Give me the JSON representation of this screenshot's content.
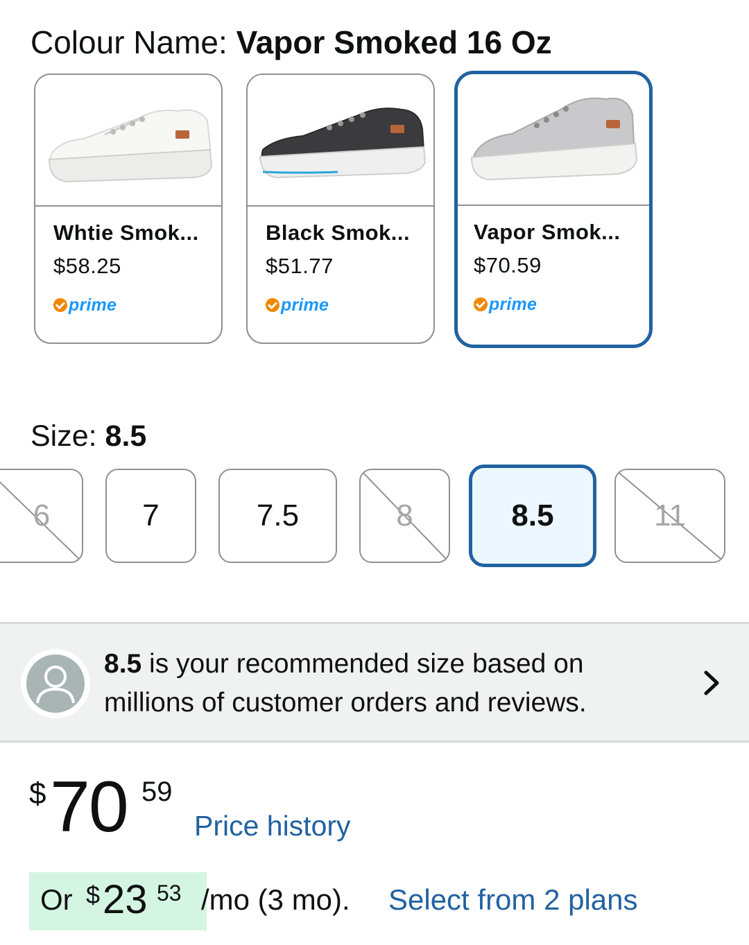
{
  "colour": {
    "label": "Colour Name: ",
    "value": "Vapor Smoked 16 Oz"
  },
  "swatches": [
    {
      "name": "Whtie Smok...",
      "price": "$58.25",
      "badge": "prime",
      "color": "white",
      "selected": false
    },
    {
      "name": "Black Smok...",
      "price": "$51.77",
      "badge": "prime",
      "color": "black",
      "selected": false
    },
    {
      "name": "Vapor Smok...",
      "price": "$70.59",
      "badge": "prime",
      "color": "grey",
      "selected": true
    }
  ],
  "size": {
    "label": "Size: ",
    "value": "8.5",
    "options": [
      {
        "label": "6",
        "available": false
      },
      {
        "label": "7",
        "available": true
      },
      {
        "label": "7.5",
        "available": true
      },
      {
        "label": "8",
        "available": false
      },
      {
        "label": "8.5",
        "available": true,
        "selected": true
      },
      {
        "label": "11",
        "available": false
      }
    ]
  },
  "recommendation": {
    "size": "8.5",
    "text": " is your recommended size based on millions of customer orders and reviews."
  },
  "price": {
    "currency": "$",
    "whole": "70",
    "fraction": "59",
    "history_link": "Price history"
  },
  "installment": {
    "prefix": "Or ",
    "currency": "$",
    "whole": "23",
    "fraction": "53",
    "suffix": " /mo (3 mo). ",
    "link": "Select from 2 plans"
  },
  "colors": {
    "selected_border": "#2162a1",
    "link": "#2162a1",
    "prime_check": "#f08804",
    "prime_word": "#1a98ff",
    "installment_highlight": "#d5f5e3",
    "selected_size_bg": "#edf7ff"
  }
}
